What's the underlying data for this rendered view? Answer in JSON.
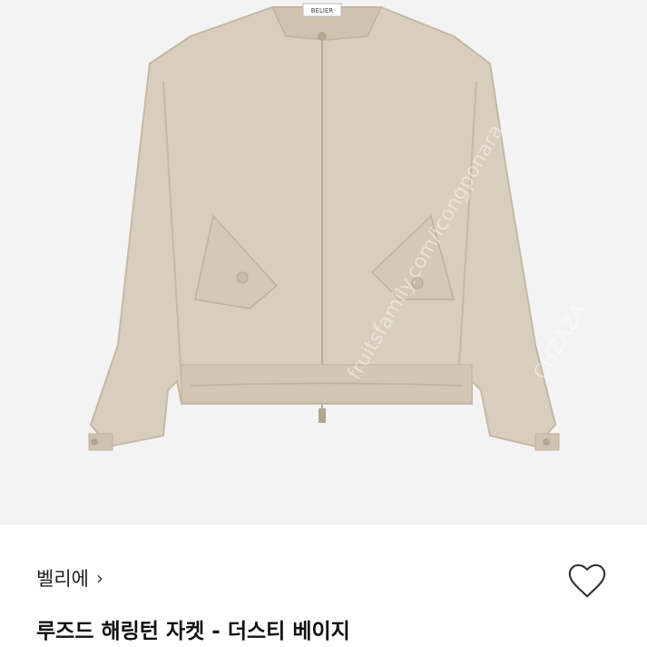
{
  "product": {
    "shop_name": "벨리에",
    "shop_chevron": "›",
    "title": "루즈드 해링턴 자켓 - 더스티 베이지",
    "label_text": "BELIER",
    "watermark_text": "fruitsfamily.com/icongponara",
    "watermark_text2": "CHZAZA"
  },
  "icons": {
    "favorite": "heart-outline-icon",
    "shop_link": "chevron-right-icon"
  },
  "colors": {
    "jacket": "#d9cdbd",
    "jacket_shadow": "#c5b8a6",
    "photo_bg": "#f3f3f3",
    "text": "#111111"
  }
}
